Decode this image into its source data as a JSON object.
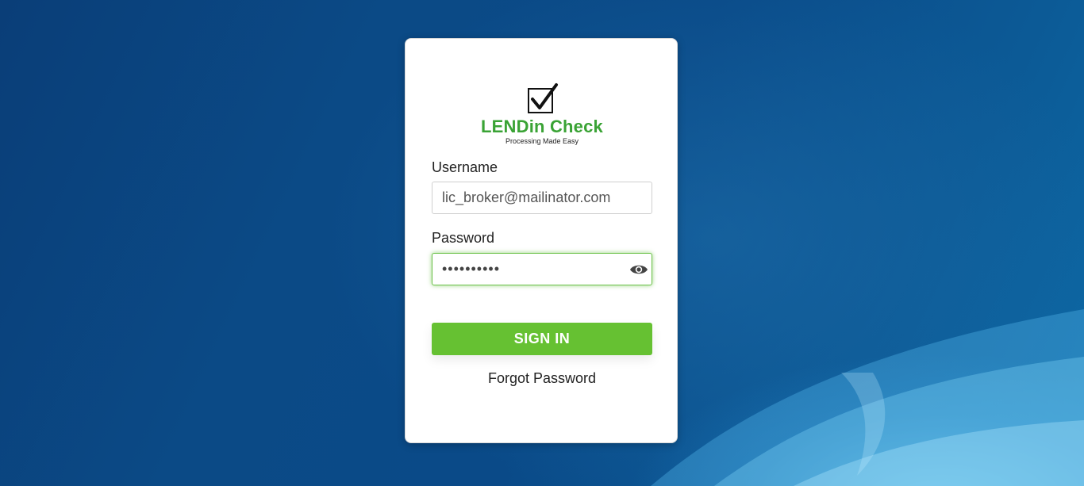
{
  "logo": {
    "name": "LENDin Check",
    "tagline": "Processing Made Easy",
    "icon": "checkbox-check-icon"
  },
  "form": {
    "username_label": "Username",
    "username_value": "lic_broker@mailinator.com",
    "password_label": "Password",
    "password_value": "••••••••••",
    "show_password_icon": "eye-icon",
    "signin_label": "SIGN IN",
    "forgot_label": "Forgot Password"
  },
  "colors": {
    "brand_green": "#3aa335",
    "button_green": "#66c132",
    "focus_border": "#6cc24a",
    "background_blue": "#0b4a86"
  }
}
